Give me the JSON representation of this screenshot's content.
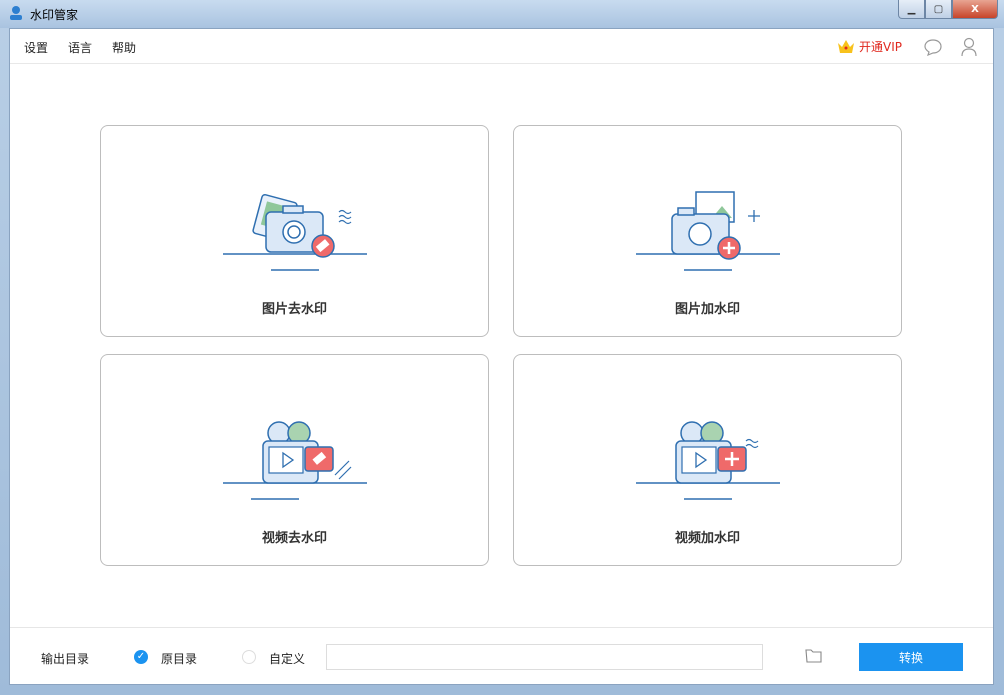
{
  "window": {
    "title": "水印管家"
  },
  "menu": {
    "items": [
      "设置",
      "语言",
      "帮助"
    ],
    "vip": "开通VIP"
  },
  "cards": [
    {
      "label": "图片去水印"
    },
    {
      "label": "图片加水印"
    },
    {
      "label": "视频去水印"
    },
    {
      "label": "视频加水印"
    }
  ],
  "bottom": {
    "output_label": "输出目录",
    "option_original": "原目录",
    "option_custom": "自定义",
    "path_value": "",
    "convert": "转换"
  },
  "colors": {
    "accent": "#1b93f0",
    "vip": "#e0281e",
    "icon_blue": "#2f6fb0",
    "icon_red": "#ef6a6a"
  }
}
